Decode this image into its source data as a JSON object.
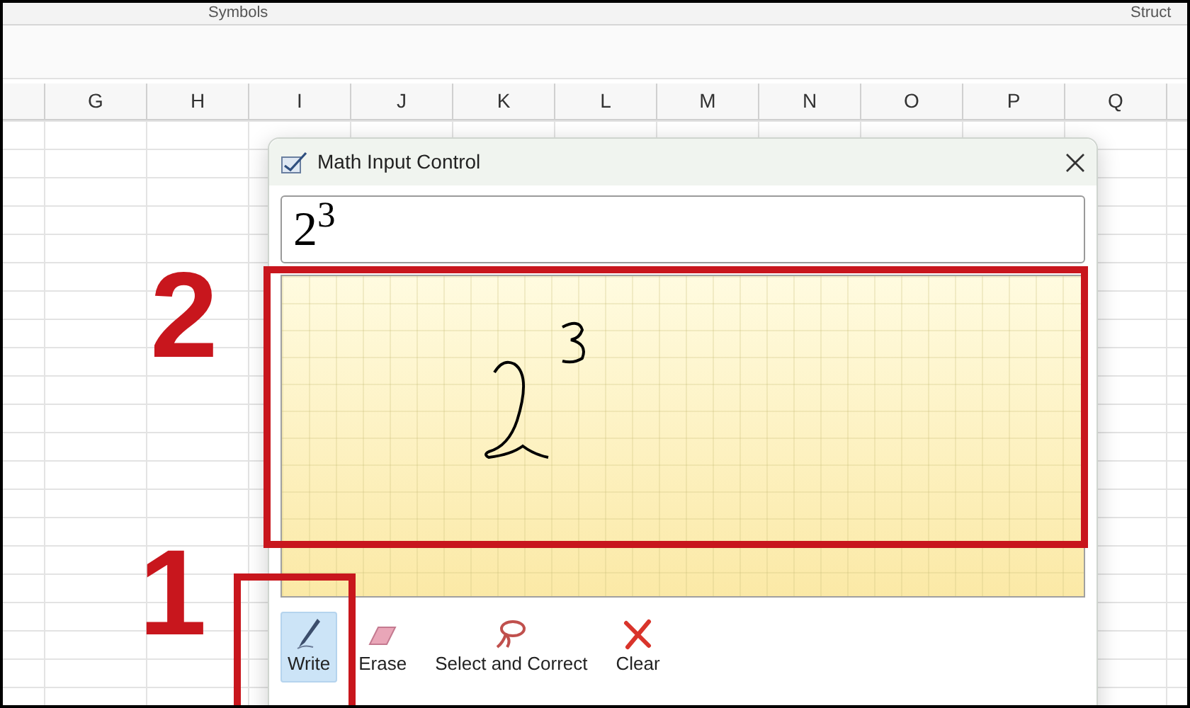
{
  "ribbon": {
    "groups": [
      "Symbols",
      "Struct"
    ]
  },
  "columns": [
    "G",
    "H",
    "I",
    "J",
    "K",
    "L",
    "M",
    "N",
    "O",
    "P",
    "Q"
  ],
  "dialog": {
    "title": "Math Input Control",
    "preview": "2$^{3}$",
    "tools": [
      {
        "kind": "write",
        "label": "Write",
        "selected": true
      },
      {
        "kind": "erase",
        "label": "Erase",
        "selected": false
      },
      {
        "kind": "select",
        "label": "Select and Correct",
        "selected": false
      },
      {
        "kind": "clear",
        "label": "Clear",
        "selected": false
      }
    ]
  },
  "annotations": [
    {
      "label": "2"
    },
    {
      "label": "1"
    }
  ]
}
